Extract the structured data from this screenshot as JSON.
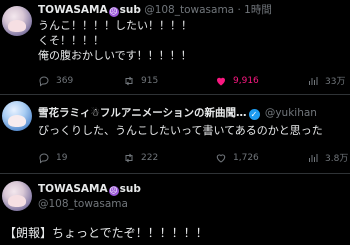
{
  "tweets": [
    {
      "name": "TOWASAMA",
      "name_suffix": "sub",
      "handle": "@108_towasama",
      "sep": "·",
      "time": "1時間",
      "lines": [
        "うんこ！！！！したい！！！！",
        "くそ！！！！",
        "俺の腹おかしいです！！！！！"
      ],
      "replies": "369",
      "retweets": "915",
      "likes": "9,916",
      "views": "33万"
    },
    {
      "name": "雪花ラミィ☃フルアニメーションの新曲聞…",
      "handle": "@yukihan",
      "lines": [
        "びっくりした、うんこしたいって書いてあるのかと思った"
      ],
      "replies": "19",
      "retweets": "222",
      "likes": "1,726",
      "views": "3.8万"
    },
    {
      "name": "TOWASAMA",
      "name_suffix": "sub",
      "handle": "@108_towasama",
      "lines": [
        "【朗報】ちょっとでたぞ！！！！！！"
      ]
    }
  ],
  "colors": {
    "bg": "#000000",
    "text": "#e7e9ea",
    "muted": "#71767b",
    "like": "#f91880",
    "verified": "#1d9bf0",
    "divider": "#2f3336"
  }
}
